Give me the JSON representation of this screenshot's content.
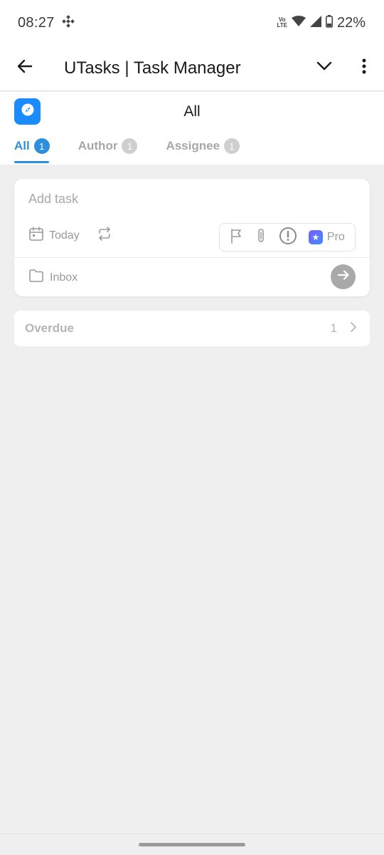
{
  "status_bar": {
    "time": "08:27",
    "battery": "22%",
    "network_label_top": "Vo",
    "network_label_bottom": "LTE"
  },
  "app_bar": {
    "title": "UTasks | Task Manager",
    "back_icon": "arrow-left-icon",
    "dropdown_icon": "chevron-down-icon",
    "menu_icon": "more-vert-icon"
  },
  "header": {
    "list_title": "All",
    "list_icon": "compass-icon",
    "accent_color": "#2e8fdc",
    "tabs": [
      {
        "label": "All",
        "count": "1",
        "active": true
      },
      {
        "label": "Author",
        "count": "1",
        "active": false
      },
      {
        "label": "Assignee",
        "count": "1",
        "active": false
      }
    ]
  },
  "add_task": {
    "placeholder": "Add task",
    "date_label": "Today",
    "pro_label": "Pro",
    "folder_label": "Inbox"
  },
  "sections": {
    "overdue_label": "Overdue",
    "overdue_count": "1"
  }
}
